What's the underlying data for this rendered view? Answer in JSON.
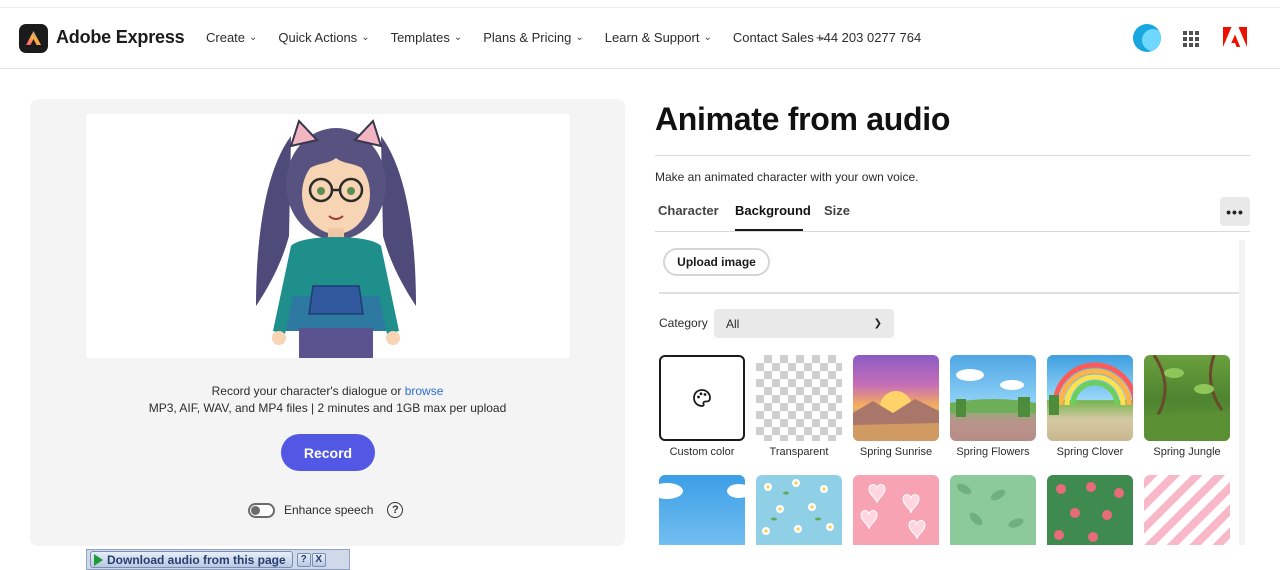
{
  "header": {
    "brand": "Adobe Express",
    "nav": [
      {
        "label": "Create"
      },
      {
        "label": "Quick Actions"
      },
      {
        "label": "Templates"
      },
      {
        "label": "Plans & Pricing"
      },
      {
        "label": "Learn & Support"
      },
      {
        "label": "Contact Sales"
      }
    ],
    "phone": "+44 203 0277 764",
    "icons": {
      "apps": "apps-grid-icon",
      "adobe": "adobe-logo-icon",
      "avatar": "user-avatar"
    }
  },
  "left": {
    "instruction_line1": "Record your character's dialogue or",
    "browse_link": "browse",
    "instruction_line2": "MP3, AIF, WAV, and MP4 files | 2 minutes and 1GB max per upload",
    "record_label": "Record",
    "enhance_label": "Enhance speech",
    "help_glyph": "?"
  },
  "right": {
    "title": "Animate from audio",
    "subtitle": "Make an animated character with your own voice.",
    "tabs": [
      {
        "label": "Character"
      },
      {
        "label": "Background"
      },
      {
        "label": "Size"
      }
    ],
    "more_glyph": "•••",
    "upload_label": "Upload image",
    "category_label": "Category",
    "category_value": "All",
    "backgrounds": [
      {
        "label": "Custom color"
      },
      {
        "label": "Transparent"
      },
      {
        "label": "Spring Sunrise"
      },
      {
        "label": "Spring Flowers"
      },
      {
        "label": "Spring Clover"
      },
      {
        "label": "Spring Jungle"
      }
    ]
  },
  "download_bar": {
    "label": "Download audio from this page",
    "help": "?",
    "close": "X"
  },
  "colors": {
    "accent": "#5258e4",
    "link": "#2d6fd1",
    "panel": "#f4f4f4"
  }
}
